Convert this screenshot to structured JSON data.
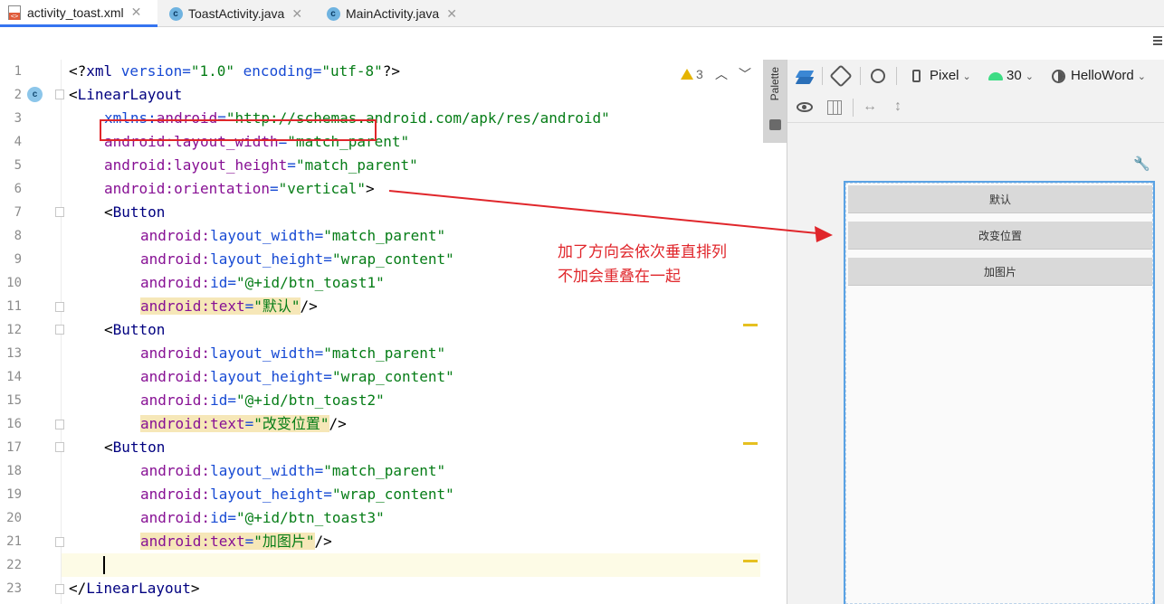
{
  "tabs": [
    {
      "label": "activity_toast.xml",
      "icon": "xml-file-icon",
      "active": true
    },
    {
      "label": "ToastActivity.java",
      "icon": "java-class-icon",
      "active": false
    },
    {
      "label": "MainActivity.java",
      "icon": "java-class-icon",
      "active": false
    }
  ],
  "editor": {
    "warning_count": "3",
    "line_numbers": [
      "1",
      "2",
      "3",
      "4",
      "5",
      "6",
      "7",
      "8",
      "9",
      "10",
      "11",
      "12",
      "13",
      "14",
      "15",
      "16",
      "17",
      "18",
      "19",
      "20",
      "21",
      "22",
      "23"
    ],
    "lines": {
      "l1": {
        "a": "<?",
        "b": "xml ",
        "c": "version=",
        "d": "\"1.0\"",
        "e": " encoding=",
        "f": "\"utf-8\"",
        "g": "?>"
      },
      "l2": {
        "a": "<",
        "b": "LinearLayout"
      },
      "l3": {
        "ns": "xmlns:",
        "attr": "android",
        "eq": "=",
        "val": "\"http://schemas.android.com/apk/res/android\""
      },
      "l4": {
        "ns": "android:",
        "attr": "layout_width",
        "eq": "=",
        "val": "\"match_parent\""
      },
      "l5": {
        "ns": "android:",
        "attr": "layout_height",
        "eq": "=",
        "val": "\"match_parent\""
      },
      "l6": {
        "ns": "android:",
        "attr": "orientation",
        "eq": "=",
        "val": "\"vertical\"",
        "end": ">"
      },
      "l7": {
        "a": "<",
        "b": "Button"
      },
      "l8": {
        "ns": "android:",
        "attr": "layout_width",
        "eq": "=",
        "val": "\"match_parent\""
      },
      "l9": {
        "ns": "android:",
        "attr": "layout_height",
        "eq": "=",
        "val": "\"wrap_content\""
      },
      "l10": {
        "ns": "android:",
        "attr": "id",
        "eq": "=",
        "val": "\"@+id/btn_toast1\""
      },
      "l11": {
        "ns": "android:",
        "attr": "text",
        "eq": "=",
        "val": "\"默认\"",
        "end": "/>"
      },
      "l12": {
        "a": "<",
        "b": "Button"
      },
      "l13": {
        "ns": "android:",
        "attr": "layout_width",
        "eq": "=",
        "val": "\"match_parent\""
      },
      "l14": {
        "ns": "android:",
        "attr": "layout_height",
        "eq": "=",
        "val": "\"wrap_content\""
      },
      "l15": {
        "ns": "android:",
        "attr": "id",
        "eq": "=",
        "val": "\"@+id/btn_toast2\""
      },
      "l16": {
        "ns": "android:",
        "attr": "text",
        "eq": "=",
        "val": "\"改变位置\"",
        "end": "/>"
      },
      "l17": {
        "a": "<",
        "b": "Button"
      },
      "l18": {
        "ns": "android:",
        "attr": "layout_width",
        "eq": "=",
        "val": "\"match_parent\""
      },
      "l19": {
        "ns": "android:",
        "attr": "layout_height",
        "eq": "=",
        "val": "\"wrap_content\""
      },
      "l20": {
        "ns": "android:",
        "attr": "id",
        "eq": "=",
        "val": "\"@+id/btn_toast3\""
      },
      "l21": {
        "ns": "android:",
        "attr": "text",
        "eq": "=",
        "val": "\"加图片\"",
        "end": "/>"
      },
      "l23": {
        "a": "</",
        "b": "LinearLayout",
        "c": ">"
      }
    }
  },
  "palette": {
    "label": "Palette"
  },
  "design_toolbar": {
    "device": "Pixel",
    "api": "30",
    "theme": "HelloWord"
  },
  "preview": {
    "buttons": [
      "默认",
      "改变位置",
      "加图片"
    ]
  },
  "annotation": {
    "line1": "加了方向会依次垂直排列",
    "line2": "不加会重叠在一起",
    "color": "#e0262b"
  },
  "colors": {
    "accent": "#3574f0",
    "xml_tag": "#000080",
    "xml_namespace": "#871094",
    "xml_attr": "#174ad4",
    "xml_string": "#067d17",
    "highlight": "#f6e7b8"
  }
}
